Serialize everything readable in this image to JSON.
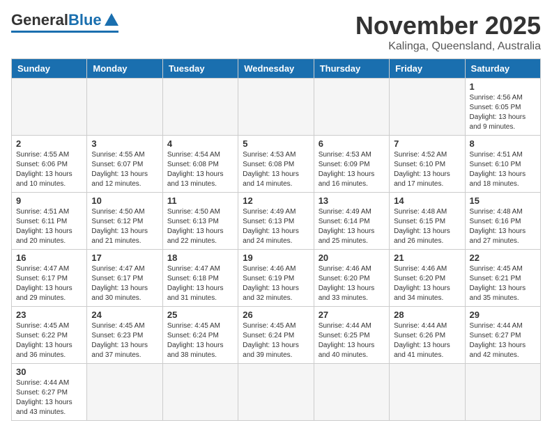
{
  "header": {
    "logo_general": "General",
    "logo_blue": "Blue",
    "month_title": "November 2025",
    "location": "Kalinga, Queensland, Australia"
  },
  "days_of_week": [
    "Sunday",
    "Monday",
    "Tuesday",
    "Wednesday",
    "Thursday",
    "Friday",
    "Saturday"
  ],
  "weeks": [
    [
      {
        "date": "",
        "info": ""
      },
      {
        "date": "",
        "info": ""
      },
      {
        "date": "",
        "info": ""
      },
      {
        "date": "",
        "info": ""
      },
      {
        "date": "",
        "info": ""
      },
      {
        "date": "",
        "info": ""
      },
      {
        "date": "1",
        "info": "Sunrise: 4:56 AM\nSunset: 6:05 PM\nDaylight: 13 hours and 9 minutes."
      }
    ],
    [
      {
        "date": "2",
        "info": "Sunrise: 4:55 AM\nSunset: 6:06 PM\nDaylight: 13 hours and 10 minutes."
      },
      {
        "date": "3",
        "info": "Sunrise: 4:55 AM\nSunset: 6:07 PM\nDaylight: 13 hours and 12 minutes."
      },
      {
        "date": "4",
        "info": "Sunrise: 4:54 AM\nSunset: 6:08 PM\nDaylight: 13 hours and 13 minutes."
      },
      {
        "date": "5",
        "info": "Sunrise: 4:53 AM\nSunset: 6:08 PM\nDaylight: 13 hours and 14 minutes."
      },
      {
        "date": "6",
        "info": "Sunrise: 4:53 AM\nSunset: 6:09 PM\nDaylight: 13 hours and 16 minutes."
      },
      {
        "date": "7",
        "info": "Sunrise: 4:52 AM\nSunset: 6:10 PM\nDaylight: 13 hours and 17 minutes."
      },
      {
        "date": "8",
        "info": "Sunrise: 4:51 AM\nSunset: 6:10 PM\nDaylight: 13 hours and 18 minutes."
      }
    ],
    [
      {
        "date": "9",
        "info": "Sunrise: 4:51 AM\nSunset: 6:11 PM\nDaylight: 13 hours and 20 minutes."
      },
      {
        "date": "10",
        "info": "Sunrise: 4:50 AM\nSunset: 6:12 PM\nDaylight: 13 hours and 21 minutes."
      },
      {
        "date": "11",
        "info": "Sunrise: 4:50 AM\nSunset: 6:13 PM\nDaylight: 13 hours and 22 minutes."
      },
      {
        "date": "12",
        "info": "Sunrise: 4:49 AM\nSunset: 6:13 PM\nDaylight: 13 hours and 24 minutes."
      },
      {
        "date": "13",
        "info": "Sunrise: 4:49 AM\nSunset: 6:14 PM\nDaylight: 13 hours and 25 minutes."
      },
      {
        "date": "14",
        "info": "Sunrise: 4:48 AM\nSunset: 6:15 PM\nDaylight: 13 hours and 26 minutes."
      },
      {
        "date": "15",
        "info": "Sunrise: 4:48 AM\nSunset: 6:16 PM\nDaylight: 13 hours and 27 minutes."
      }
    ],
    [
      {
        "date": "16",
        "info": "Sunrise: 4:47 AM\nSunset: 6:17 PM\nDaylight: 13 hours and 29 minutes."
      },
      {
        "date": "17",
        "info": "Sunrise: 4:47 AM\nSunset: 6:17 PM\nDaylight: 13 hours and 30 minutes."
      },
      {
        "date": "18",
        "info": "Sunrise: 4:47 AM\nSunset: 6:18 PM\nDaylight: 13 hours and 31 minutes."
      },
      {
        "date": "19",
        "info": "Sunrise: 4:46 AM\nSunset: 6:19 PM\nDaylight: 13 hours and 32 minutes."
      },
      {
        "date": "20",
        "info": "Sunrise: 4:46 AM\nSunset: 6:20 PM\nDaylight: 13 hours and 33 minutes."
      },
      {
        "date": "21",
        "info": "Sunrise: 4:46 AM\nSunset: 6:20 PM\nDaylight: 13 hours and 34 minutes."
      },
      {
        "date": "22",
        "info": "Sunrise: 4:45 AM\nSunset: 6:21 PM\nDaylight: 13 hours and 35 minutes."
      }
    ],
    [
      {
        "date": "23",
        "info": "Sunrise: 4:45 AM\nSunset: 6:22 PM\nDaylight: 13 hours and 36 minutes."
      },
      {
        "date": "24",
        "info": "Sunrise: 4:45 AM\nSunset: 6:23 PM\nDaylight: 13 hours and 37 minutes."
      },
      {
        "date": "25",
        "info": "Sunrise: 4:45 AM\nSunset: 6:24 PM\nDaylight: 13 hours and 38 minutes."
      },
      {
        "date": "26",
        "info": "Sunrise: 4:45 AM\nSunset: 6:24 PM\nDaylight: 13 hours and 39 minutes."
      },
      {
        "date": "27",
        "info": "Sunrise: 4:44 AM\nSunset: 6:25 PM\nDaylight: 13 hours and 40 minutes."
      },
      {
        "date": "28",
        "info": "Sunrise: 4:44 AM\nSunset: 6:26 PM\nDaylight: 13 hours and 41 minutes."
      },
      {
        "date": "29",
        "info": "Sunrise: 4:44 AM\nSunset: 6:27 PM\nDaylight: 13 hours and 42 minutes."
      }
    ],
    [
      {
        "date": "30",
        "info": "Sunrise: 4:44 AM\nSunset: 6:27 PM\nDaylight: 13 hours and 43 minutes."
      },
      {
        "date": "",
        "info": ""
      },
      {
        "date": "",
        "info": ""
      },
      {
        "date": "",
        "info": ""
      },
      {
        "date": "",
        "info": ""
      },
      {
        "date": "",
        "info": ""
      },
      {
        "date": "",
        "info": ""
      }
    ]
  ]
}
